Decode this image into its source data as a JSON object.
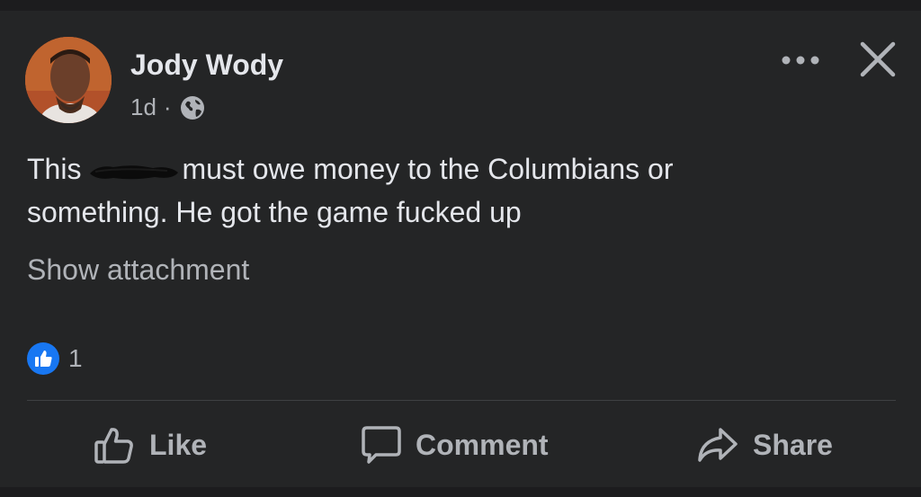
{
  "post": {
    "author": "Jody Wody",
    "timestamp": "1d",
    "separator": "·",
    "privacy_icon": "globe-icon",
    "text_before": "This",
    "text_after": "must owe money to the Columbians or something. He got the game fucked up",
    "show_attachment": "Show attachment"
  },
  "reactions": {
    "icon": "thumbs-up-icon",
    "count": "1"
  },
  "actions": {
    "like": "Like",
    "comment": "Comment",
    "share": "Share"
  },
  "colors": {
    "background": "#242526",
    "text": "#e4e6eb",
    "secondary_text": "#b0b3b8",
    "accent": "#1877f2"
  }
}
